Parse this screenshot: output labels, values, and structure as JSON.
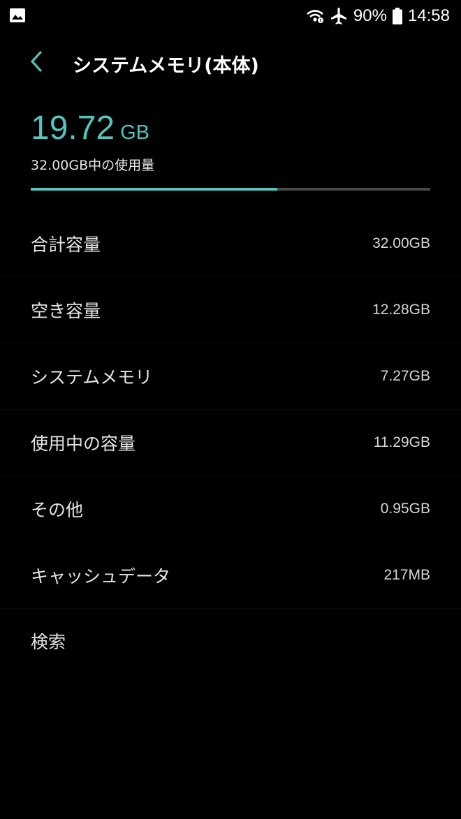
{
  "status_bar": {
    "battery_percent": "90%",
    "time": "14:58"
  },
  "header": {
    "title": "システムメモリ(本体)"
  },
  "summary": {
    "used_value": "19.72",
    "used_unit": "GB",
    "caption": "32.00GB中の使用量",
    "usage_fraction": 0.6163
  },
  "rows": [
    {
      "label": "合計容量",
      "value": "32.00GB"
    },
    {
      "label": "空き容量",
      "value": "12.28GB"
    },
    {
      "label": "システムメモリ",
      "value": "7.27GB"
    },
    {
      "label": "使用中の容量",
      "value": "11.29GB"
    },
    {
      "label": "その他",
      "value": "0.95GB"
    },
    {
      "label": "キャッシュデータ",
      "value": "217MB"
    }
  ],
  "search": {
    "label": "検索"
  },
  "colors": {
    "accent": "#53c4be",
    "background": "#000000",
    "track": "#4a4a4a"
  }
}
